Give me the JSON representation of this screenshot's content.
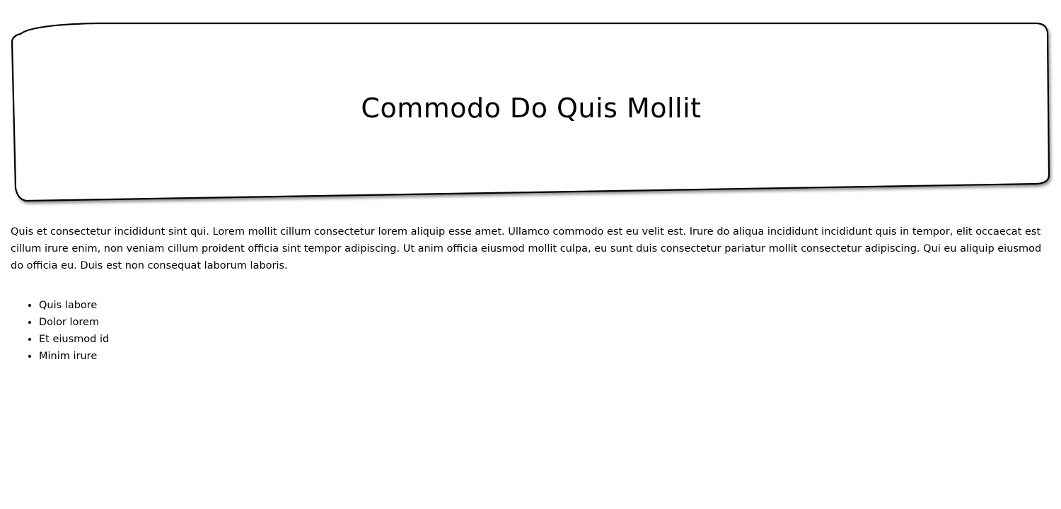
{
  "header": {
    "title": "Commodo Do Quis Mollit"
  },
  "main": {
    "paragraph": "Quis et consectetur incididunt sint qui. Lorem mollit cillum consectetur lorem aliquip esse amet. Ullamco commodo est eu velit est. Irure do aliqua incididunt incididunt quis in tempor, elit occaecat est cillum irure enim, non veniam cillum proident officia sint tempor adipiscing. Ut anim officia eiusmod mollit culpa, eu sunt duis consectetur pariatur mollit consectetur adipiscing. Qui eu aliquip eiusmod do officia eu. Duis est non consequat laborum laboris.",
    "list": [
      "Quis labore",
      "Dolor lorem",
      "Et eiusmod id",
      "Minim irure"
    ]
  }
}
